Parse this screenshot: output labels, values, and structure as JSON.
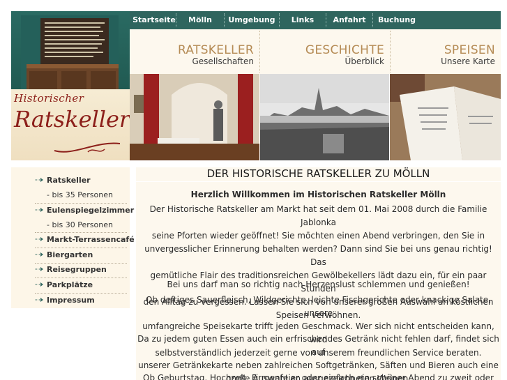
{
  "logo": {
    "line1": "Historischer",
    "line2": "Ratskeller"
  },
  "topnav": {
    "items": [
      "Startseite",
      "Mölln",
      "Umgebung",
      "Links",
      "Anfahrt",
      "Buchung"
    ]
  },
  "categories": [
    {
      "title": "RATSKELLER",
      "subtitle": "Gesellschaften"
    },
    {
      "title": "GESCHICHTE",
      "subtitle": "Überblick"
    },
    {
      "title": "SPEISEN",
      "subtitle": "Unsere Karte"
    }
  ],
  "sidebar": {
    "items": [
      {
        "label": "Ratskeller",
        "sub": "- bis 35 Personen"
      },
      {
        "label": "Eulenspiegelzimmer",
        "sub": "- bis 30 Personen"
      },
      {
        "label": "Markt-Terrassencafé"
      },
      {
        "label": "Biergarten"
      },
      {
        "label": "Reisegruppen"
      },
      {
        "label": "Parkplätze"
      },
      {
        "label": "Impressum"
      }
    ]
  },
  "content": {
    "heading": "DER HISTORISCHE RATSKELLER ZU MÖLLN",
    "welcome": "Herzlich Willkommen im Historischen Ratskeller Mölln",
    "paragraphs": [
      [
        "Der Historische Ratskeller am Markt hat seit dem 01. Mai 2008 durch die Familie Jablonka",
        "seine Pforten wieder geöffnet! Sie möchten einen Abend verbringen, den Sie in",
        "unvergesslicher Erinnerung behalten werden? Dann sind Sie bei uns genau richtig! Das",
        "gemütliche Flair des traditionsreichen Gewölbekellers lädt dazu ein, für ein paar Stunden",
        "den Alltag zu vergessen. Lassen Sie sich von unserer großen Auswahl an köstlichen",
        "Speisen verwöhnen."
      ],
      [
        "Bei uns darf man so richtig nach Herzenslust schlemmen und genießen!"
      ],
      [
        "Ob deftiges Sauerfleisch, Wildgerichte, leichte Fischgerichte oder knackige Salate, unsere",
        "umfangreiche Speisekarte trifft jeden Geschmack. Wer sich nicht entscheiden kann, wird",
        "selbstverständlich jederzeit gerne von unserem freundlichen Service beraten."
      ],
      [
        "Da zu jedem guten Essen auch ein erfrischendes Getränk nicht fehlen darf, findet sich auf",
        "unserer Getränkekarte neben zahlreichen Softgetränken, Säften und Bieren auch eine",
        "große Auswahl an ausgezeichneten Weinen."
      ],
      [
        "Ob Geburtstag, Hochzeit, Firmenfeier oder einfach ein schöner Abend zu zweit oder mit"
      ]
    ]
  },
  "colors": {
    "nav_bg": "#2f655e",
    "category_title": "#b58b55",
    "logo_red": "#8c1f1a",
    "panel_bg": "#fdf8ee"
  }
}
